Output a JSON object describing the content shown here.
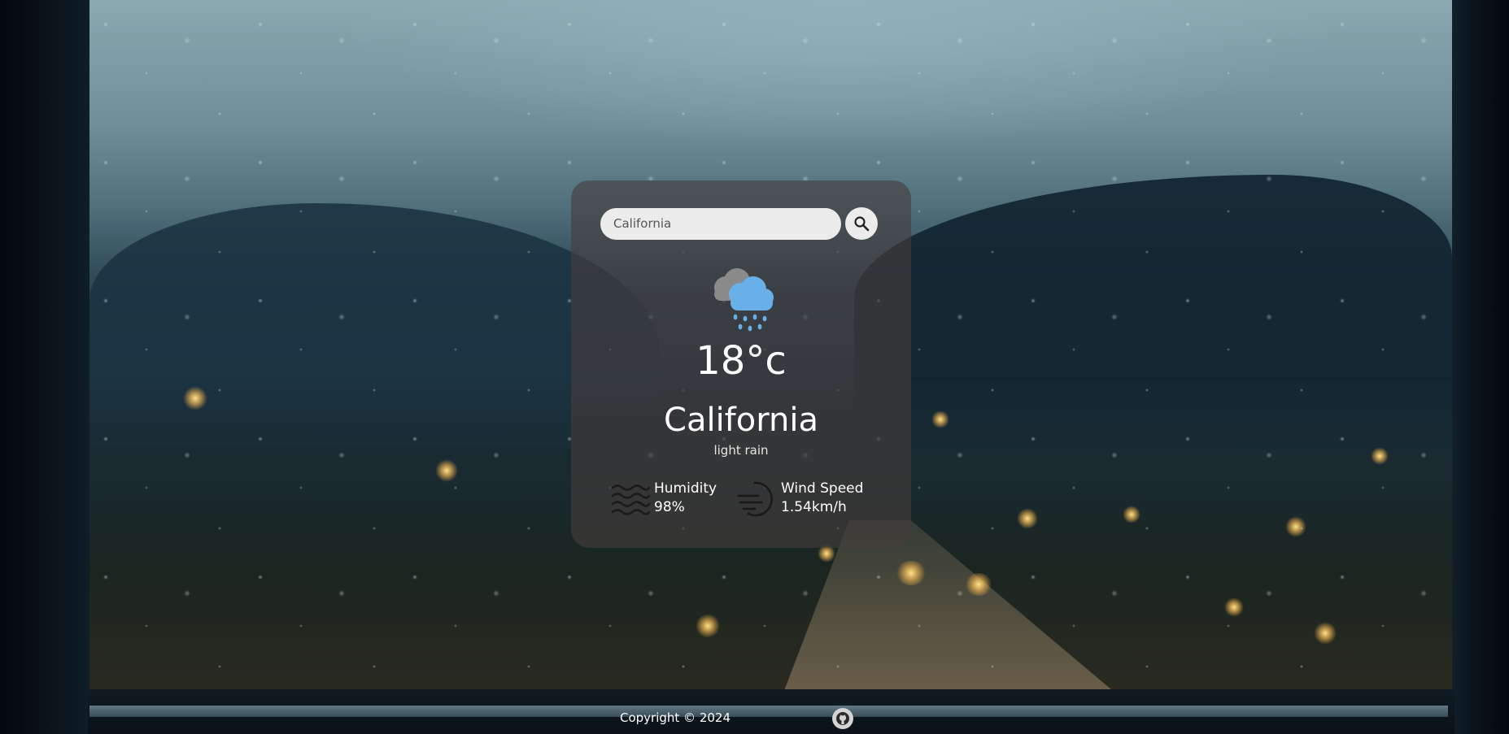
{
  "search": {
    "value": "California",
    "icon": "search-icon"
  },
  "weather": {
    "icon": "rain-cloud-icon",
    "temperature": "18°c",
    "city": "California",
    "description": "light rain"
  },
  "details": {
    "humidity": {
      "icon": "humidity-waves-icon",
      "label": "Humidity",
      "value": "98%"
    },
    "wind": {
      "icon": "wind-icon",
      "label": "Wind Speed",
      "value": "1.54km/h"
    }
  },
  "footer": {
    "copyright": "Copyright © 2024",
    "github_icon": "github-icon"
  },
  "colors": {
    "card_bg": "#463e3c",
    "input_bg": "#ececec",
    "text": "#ffffff",
    "cloud_front": "#6ab0e8",
    "cloud_back": "#7d7d7d"
  }
}
